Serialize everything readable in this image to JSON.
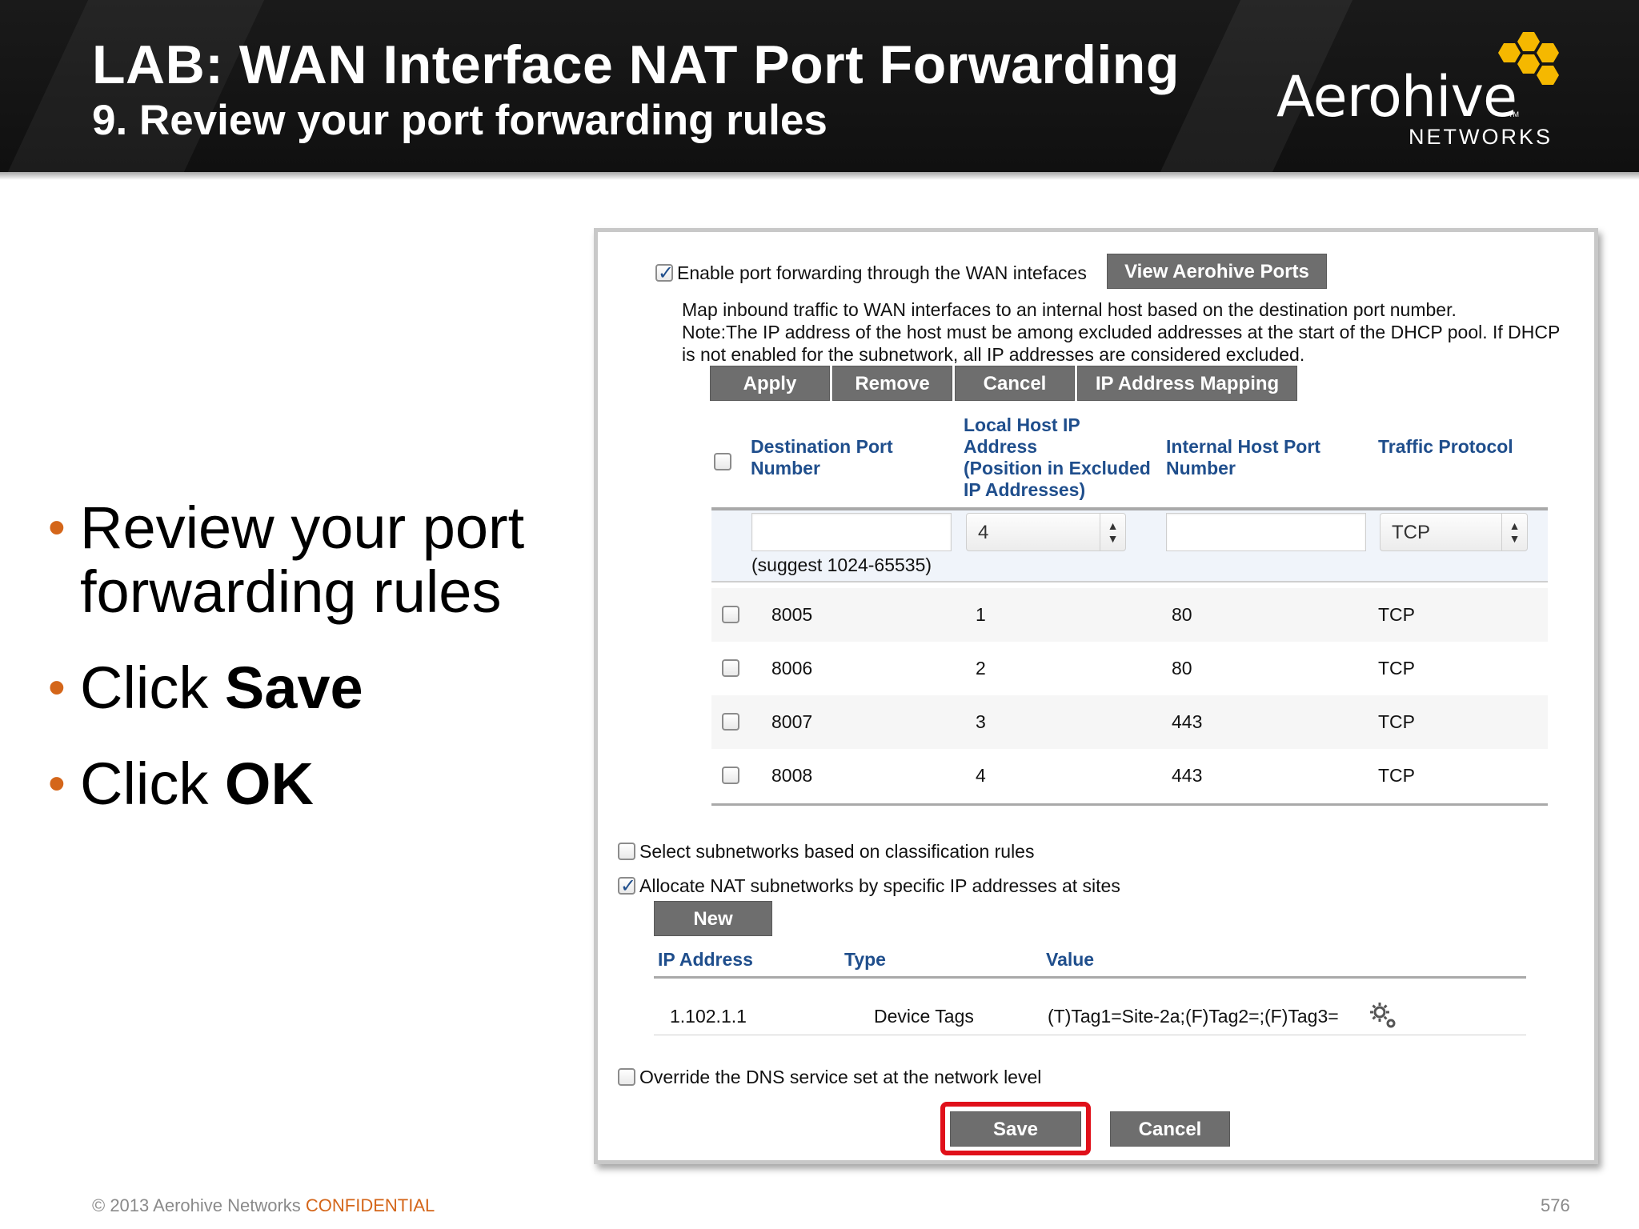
{
  "header": {
    "title": "LAB: WAN Interface NAT Port Forwarding",
    "subtitle": "9. Review your port forwarding rules"
  },
  "logo": {
    "wordmark": "Aerohive",
    "tm": "TM",
    "sub": "NETWORKS",
    "color": "#f5b800"
  },
  "bullets": [
    {
      "text": "Review your port forwarding rules",
      "bold": ""
    },
    {
      "text": "Click ",
      "bold": "Save"
    },
    {
      "text": "Click ",
      "bold": "OK"
    }
  ],
  "bullet_char": "•",
  "footer": {
    "copyright": "© 2013 Aerohive Networks ",
    "confidential": "CONFIDENTIAL",
    "page": "576"
  },
  "panel": {
    "enable_port_forwarding": {
      "label": "Enable port forwarding through the WAN intefaces",
      "checked": true
    },
    "view_ports_button": "View Aerohive Ports",
    "description_line1": "Map inbound traffic to WAN interfaces to an internal host based on the destination port number.",
    "description_line2": "Note:The IP address of the host must be among excluded addresses at the start of the DHCP pool. If DHCP",
    "description_line3": "is not enabled for the subnetwork, all IP addresses are considered excluded.",
    "action_buttons": {
      "apply": "Apply",
      "remove": "Remove",
      "cancel": "Cancel",
      "ip_mapping": "IP Address Mapping"
    },
    "table_headers": {
      "dest_port_1": "Destination Port",
      "dest_port_2": "Number",
      "local_ip_1": "Local Host IP",
      "local_ip_2": "Address",
      "local_ip_3": "(Position in Excluded",
      "local_ip_4": "IP Addresses)",
      "internal_port_1": "Internal Host Port",
      "internal_port_2": "Number",
      "protocol": "Traffic Protocol"
    },
    "new_rule": {
      "dest_port_value": "",
      "position_value": "4",
      "internal_port_value": "",
      "protocol_value": "TCP",
      "suggest": "(suggest 1024-65535)"
    },
    "rules": [
      {
        "dest_port": "8005",
        "position": "1",
        "internal_port": "80",
        "protocol": "TCP"
      },
      {
        "dest_port": "8006",
        "position": "2",
        "internal_port": "80",
        "protocol": "TCP"
      },
      {
        "dest_port": "8007",
        "position": "3",
        "internal_port": "443",
        "protocol": "TCP"
      },
      {
        "dest_port": "8008",
        "position": "4",
        "internal_port": "443",
        "protocol": "TCP"
      }
    ],
    "select_subnetworks": {
      "label": "Select subnetworks based on classification rules",
      "checked": false
    },
    "allocate_nat": {
      "label": "Allocate NAT subnetworks by specific IP addresses at sites",
      "checked": true
    },
    "new_button": "New",
    "nat_headers": {
      "ip": "IP Address",
      "type": "Type",
      "value": "Value"
    },
    "nat_row": {
      "ip": "1.102.1.1",
      "type": "Device Tags",
      "value": "(T)Tag1=Site-2a;(F)Tag2=;(F)Tag3="
    },
    "override_dns": {
      "label": "Override the DNS service set at the network level",
      "checked": false
    },
    "save_button": "Save",
    "cancel_button": "Cancel",
    "highlight_color": "#e0101a"
  }
}
